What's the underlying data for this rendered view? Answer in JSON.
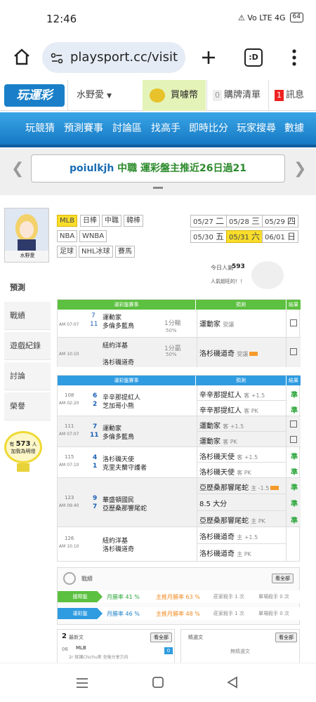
{
  "status": {
    "time": "12:46",
    "icons": "⚠ Vo LTE 4G",
    "battery": "64"
  },
  "browser": {
    "url": "playsport.cc/visit",
    "tab_count": ":D"
  },
  "site": {
    "logo": "玩運彩",
    "user": "水野愛",
    "coin": "買噱幣",
    "cart_count": "0",
    "cart": "購牌清單",
    "msg_count": "1",
    "msg": "訊息"
  },
  "nav": [
    "玩競猜",
    "預測賽事",
    "討論區",
    "找高手",
    "即時比分",
    "玩家搜尋",
    "數據"
  ],
  "marquee": {
    "user": "poiulkjh",
    "text": " 中職 運彩盤主推近26日過21"
  },
  "sidebar": {
    "name": "水野愛",
    "items": [
      "預測",
      "戰績",
      "遊戲紀錄",
      "討論",
      "榮譽"
    ],
    "badge_prefix": "有",
    "badge_count": "573",
    "badge_unit": "人",
    "badge_sub": "加我為明燈"
  },
  "leagues": [
    "MLB",
    "日棒",
    "中職",
    "韓棒",
    "NBA",
    "WNBA",
    "足球",
    "NHL冰球",
    "賽馬"
  ],
  "dates": [
    {
      "d": "05/27",
      "w": "二"
    },
    {
      "d": "05/28",
      "w": "三"
    },
    {
      "d": "05/29",
      "w": "四"
    },
    {
      "d": "05/30",
      "w": "五"
    },
    {
      "d": "05/31",
      "w": "六"
    },
    {
      "d": "06/01",
      "w": "日"
    }
  ],
  "popularity": {
    "label": "今日人氣",
    "value": "593",
    "sub": "人氣超旺的！！"
  },
  "intl": {
    "header": [
      "運彩盤賽事",
      "預測",
      "結果"
    ],
    "rows": [
      {
        "time": "AM 07:07",
        "n1": "7",
        "t1": "運動家",
        "n2": "11",
        "t2": "多倫多藍鳥",
        "odds": "1分輸",
        "pct": "50%",
        "pred": "運動家",
        "ptag": "受讓"
      },
      {
        "time": "AM 10:10",
        "n1": "",
        "t1": "紐約洋基",
        "n2": "",
        "t2": "洛杉磯道奇",
        "odds": "1分贏",
        "pct": "50%",
        "pred": "洛杉磯道奇",
        "ptag": "受讓"
      }
    ]
  },
  "lottery": {
    "header": [
      "運彩盤賽事",
      "預測",
      "結果"
    ],
    "rows": [
      {
        "num": "108",
        "time": "AM 02:20",
        "n1": "6",
        "t1": "辛辛那提紅人",
        "n2": "2",
        "t2": "芝加哥小熊",
        "preds": [
          {
            "t": "辛辛那提紅人",
            "tag": "客 +1.5",
            "r": "準"
          },
          {
            "t": "辛辛那提紅人",
            "tag": "客 PK",
            "r": "準"
          }
        ]
      },
      {
        "num": "111",
        "time": "AM 07:07",
        "n1": "7",
        "t1": "運動家",
        "n2": "11",
        "t2": "多倫多藍鳥",
        "preds": [
          {
            "t": "運動家",
            "tag": "客 +1.5",
            "r": ""
          },
          {
            "t": "運動家",
            "tag": "客 PK",
            "r": ""
          }
        ]
      },
      {
        "num": "115",
        "time": "AM 07:10",
        "n1": "4",
        "t1": "洛杉磯天使",
        "n2": "1",
        "t2": "克里夫蘭守護者",
        "preds": [
          {
            "t": "洛杉磯天使",
            "tag": "客 +1.5",
            "r": "準"
          },
          {
            "t": "洛杉磯天使",
            "tag": "客 PK",
            "r": "準"
          }
        ]
      },
      {
        "num": "123",
        "time": "AM 09:40",
        "n1": "9",
        "t1": "華盛頓國民",
        "n2": "7",
        "t2": "亞歷桑那響尾蛇",
        "preds": [
          {
            "t": "亞歷桑那響尾蛇",
            "tag": "主 -1.5",
            "r": "準"
          },
          {
            "t": "8.5 大分",
            "tag": "",
            "r": "準"
          },
          {
            "t": "亞歷桑那響尾蛇",
            "tag": "主 PK",
            "r": "準"
          }
        ]
      },
      {
        "num": "126",
        "time": "AM 10:10",
        "n1": "",
        "t1": "紐約洋基",
        "n2": "",
        "t2": "洛杉磯道奇",
        "preds": [
          {
            "t": "洛杉磯道奇",
            "tag": "主 +1.5",
            "r": ""
          },
          {
            "t": "洛杉磯道奇",
            "tag": "主 PK",
            "r": ""
          }
        ]
      }
    ]
  },
  "record": {
    "title": "戰績",
    "more": "看全部",
    "rows": [
      {
        "label": "國際盤",
        "win": "月勝率 41 %",
        "main": "主推月勝率 63 %",
        "kill": "莊家殺手 1 次",
        "single": "單場殺手 0 次"
      },
      {
        "label": "運彩盤",
        "win": "月勝率 46 %",
        "main": "主推月勝率 48 %",
        "kill": "莊家殺手 1 次",
        "single": "單場殺手 0 次"
      }
    ]
  },
  "posts": {
    "left_count": "2",
    "left_title": "最新文",
    "more": "看全部",
    "right_title": "精選文",
    "right_more": "看全部",
    "empty": "無精選文",
    "item_date": "06",
    "item_league": "MLB",
    "item_text": "2r 就讓Chichu來 坐後分享方向",
    "item_tag": "0"
  }
}
